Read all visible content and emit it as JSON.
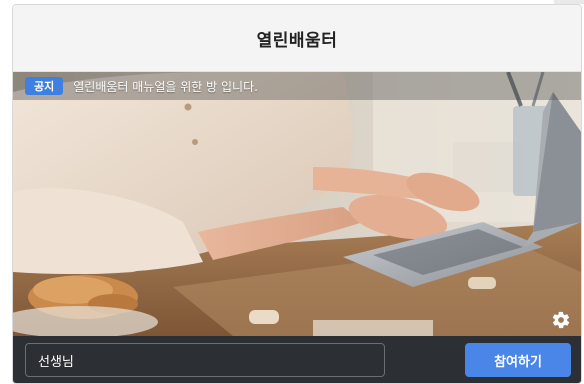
{
  "header": {
    "title": "열린배움터"
  },
  "notice": {
    "badge": "공지",
    "text": "열린배움터 매뉴얼을 위한 방 입니다."
  },
  "hero": {
    "image_description_icon": "laptop-desk-photo"
  },
  "footer": {
    "name_value": "선생님",
    "join_label": "참여하기"
  },
  "icons": {
    "settings": "gear-icon"
  },
  "colors": {
    "accent": "#4a86e8",
    "badge": "#3f7fe0",
    "footer_bg": "#2c2f33",
    "header_bg": "#f4f4f4"
  }
}
